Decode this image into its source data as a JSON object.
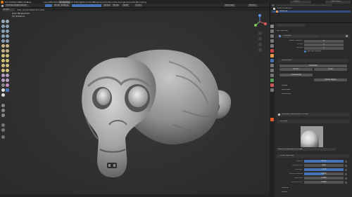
{
  "menu": {
    "items": [
      "File",
      "Edit",
      "Render",
      "Window",
      "Help"
    ],
    "workspaces": [
      "Layout",
      "Modeling",
      "Sculpting",
      "UV Editing",
      "Texture Paint",
      "Shading",
      "Animation",
      "Rendering",
      "Compositing",
      "Scripting"
    ],
    "active_workspace": "Sculpting",
    "scene_label": "Scene",
    "view_layer_label": "View Layer"
  },
  "tool_settings": {
    "brush": "Multires Displacement",
    "chips": [
      "Brush",
      "Settings",
      "Texture",
      "Stroke",
      "Falloff",
      "Cursor"
    ],
    "mode": "Sculpt Mode",
    "view_items": [
      "View",
      "Sculpt",
      "Mask",
      "Face Sets"
    ],
    "symmetry": "Symmetry",
    "options": "Options"
  },
  "viewport": {
    "perspective_label": "User Perspective",
    "object_label": "(0) Suzanne"
  },
  "outliner": {
    "title": "Scene Collection",
    "row": "Suzanne"
  },
  "properties": {
    "modifier_name": "Multires",
    "add_modifier": "Add Modifier",
    "levels": [
      {
        "label": "Level Viewport",
        "value": "3"
      },
      {
        "label": "Sculpt",
        "value": "3"
      },
      {
        "label": "Render",
        "value": "3"
      }
    ],
    "optimal_display": "Optimal Display",
    "subdivision_header": "Subdivision",
    "subdivide_btn": "Subdivide",
    "simple_btn": "Simple",
    "linear_btn": "Linear",
    "unsubdivide_btn": "Unsubdivide",
    "delete_higher_btn": "Delete Higher",
    "shape_header": "Shape",
    "generate_header": "Generate",
    "advanced_header": "Advanced",
    "tool_panel": "Multires Displacement Eraser",
    "brushes_header": "Brushes",
    "brush_preview_name": "Multires Displacement Eraser",
    "brush_settings_header": "Brush Settings",
    "brush_settings": [
      {
        "label": "Radius",
        "value": "50 px",
        "fill": 1.0
      },
      {
        "label": "Radius Unit",
        "value": "View",
        "fill": 0.0
      },
      {
        "label": "Strength",
        "value": "1.000",
        "fill": 1.0
      },
      {
        "label": "Normal Radius",
        "value": "0.500",
        "fill": 0.5
      },
      {
        "label": "Hardness",
        "value": "0.000",
        "fill": 0.0
      },
      {
        "label": "Autosmooth",
        "value": "0.000",
        "fill": 0.0
      }
    ],
    "texture_header": "Texture",
    "stroke_header": "Stroke"
  },
  "colors": {
    "accent": "#4772b3",
    "active_tab": "#e55a2b"
  }
}
